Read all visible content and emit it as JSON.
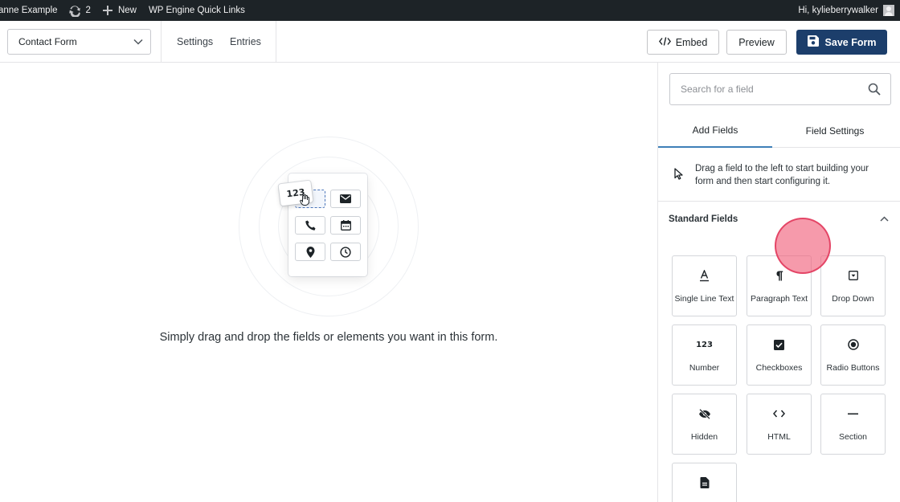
{
  "admin_bar": {
    "site_name": "anne Example",
    "updates_count": "2",
    "new_label": "New",
    "quick_links_label": "WP Engine Quick Links",
    "greeting": "Hi, kylieberrywalker"
  },
  "toolbar": {
    "form_selector_value": "Contact Form",
    "settings_link": "Settings",
    "entries_link": "Entries",
    "embed_label": "Embed",
    "preview_label": "Preview",
    "save_label": "Save Form"
  },
  "canvas": {
    "empty_message": "Simply drag and drop the fields or elements you want in this form.",
    "illustration_drag_label": "123"
  },
  "sidebar": {
    "search_placeholder": "Search for a field",
    "tabs": [
      {
        "label": "Add Fields",
        "active": true
      },
      {
        "label": "Field Settings",
        "active": false
      }
    ],
    "hint": "Drag a field to the left to start building your form and then start configuring it.",
    "section_title": "Standard Fields",
    "fields": [
      {
        "label": "Single Line Text",
        "icon": "single-line-text-icon"
      },
      {
        "label": "Paragraph Text",
        "icon": "paragraph-icon"
      },
      {
        "label": "Drop Down",
        "icon": "dropdown-icon"
      },
      {
        "label": "Number",
        "icon": "number-icon"
      },
      {
        "label": "Checkboxes",
        "icon": "checkbox-icon"
      },
      {
        "label": "Radio Buttons",
        "icon": "radio-icon"
      },
      {
        "label": "Hidden",
        "icon": "hidden-icon"
      },
      {
        "label": "HTML",
        "icon": "code-icon"
      },
      {
        "label": "Section",
        "icon": "section-icon"
      },
      {
        "label": "",
        "icon": "document-icon"
      }
    ]
  },
  "colors": {
    "admin_bar_bg": "#1d2327",
    "primary_button": "#1c3e6b",
    "active_tab_underline": "#3e7fb8",
    "click_marker": "#f15c78"
  }
}
